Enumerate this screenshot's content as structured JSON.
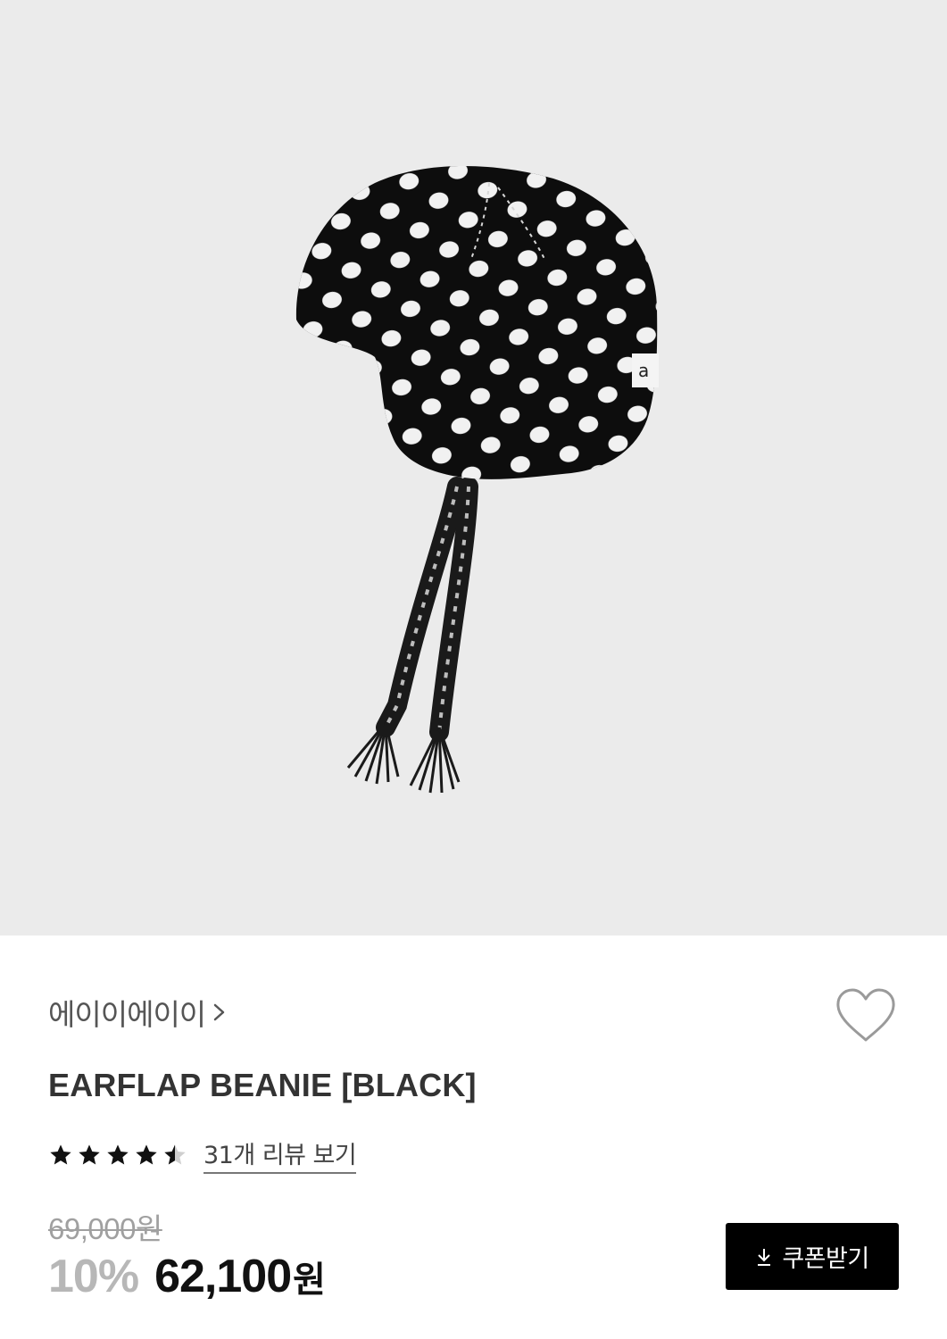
{
  "product": {
    "brand": "에이이에이이",
    "title": "EARFLAP BEANIE [BLACK]",
    "image_icon": "polka-dot-earflap-beanie",
    "label_text": "a"
  },
  "rating": {
    "value": 4.5,
    "max": 5,
    "reviews_label": "31개 리뷰 보기"
  },
  "price": {
    "original": "69,000원",
    "discount": "10%",
    "final": "62,100",
    "final_unit": "원"
  },
  "actions": {
    "coupon_label": "쿠폰받기",
    "coupon_icon": "download-icon",
    "wishlist_icon": "heart-icon"
  },
  "colors": {
    "hero_bg": "#ebebeb",
    "primary": "#000000",
    "muted": "#a0a0a0"
  }
}
